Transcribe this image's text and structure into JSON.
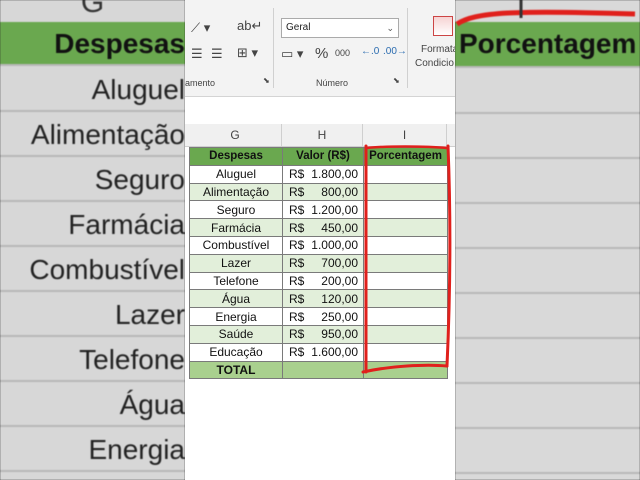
{
  "background": {
    "col_letter": "G",
    "left_rows": [
      "Despesas",
      "Aluguel",
      "Alimentação",
      "Seguro",
      "Farmácia",
      "Combustível",
      "Lazer",
      "Telefone",
      "Água",
      "Energia"
    ],
    "right_header": "Porcentagem"
  },
  "ribbon": {
    "number_format": "Geral",
    "percent_symbol": "%",
    "thousands_symbol": "000",
    "alignment_group_label": "amento",
    "number_group_label": "Número",
    "cond_format_label_1": "Formata",
    "cond_format_label_2": "Condicio"
  },
  "sheet": {
    "column_headers": [
      "G",
      "H",
      "I"
    ],
    "headers": [
      "Despesas",
      "Valor (R$)",
      "Porcentagem"
    ],
    "rows": [
      {
        "expense": "Aluguel",
        "currency": "R$",
        "amount": "1.800,00"
      },
      {
        "expense": "Alimentação",
        "currency": "R$",
        "amount": "800,00"
      },
      {
        "expense": "Seguro",
        "currency": "R$",
        "amount": "1.200,00"
      },
      {
        "expense": "Farmácia",
        "currency": "R$",
        "amount": "450,00"
      },
      {
        "expense": "Combustível",
        "currency": "R$",
        "amount": "1.000,00"
      },
      {
        "expense": "Lazer",
        "currency": "R$",
        "amount": "700,00"
      },
      {
        "expense": "Telefone",
        "currency": "R$",
        "amount": "200,00"
      },
      {
        "expense": "Água",
        "currency": "R$",
        "amount": "120,00"
      },
      {
        "expense": "Energia",
        "currency": "R$",
        "amount": "250,00"
      },
      {
        "expense": "Saúde",
        "currency": "R$",
        "amount": "950,00"
      },
      {
        "expense": "Educação",
        "currency": "R$",
        "amount": "1.600,00"
      }
    ],
    "total_label": "TOTAL"
  },
  "colors": {
    "header_green": "#6aa84f",
    "alt_row_green": "#e2efda",
    "total_green": "#a9d08e",
    "marker_red": "#e0201c"
  }
}
